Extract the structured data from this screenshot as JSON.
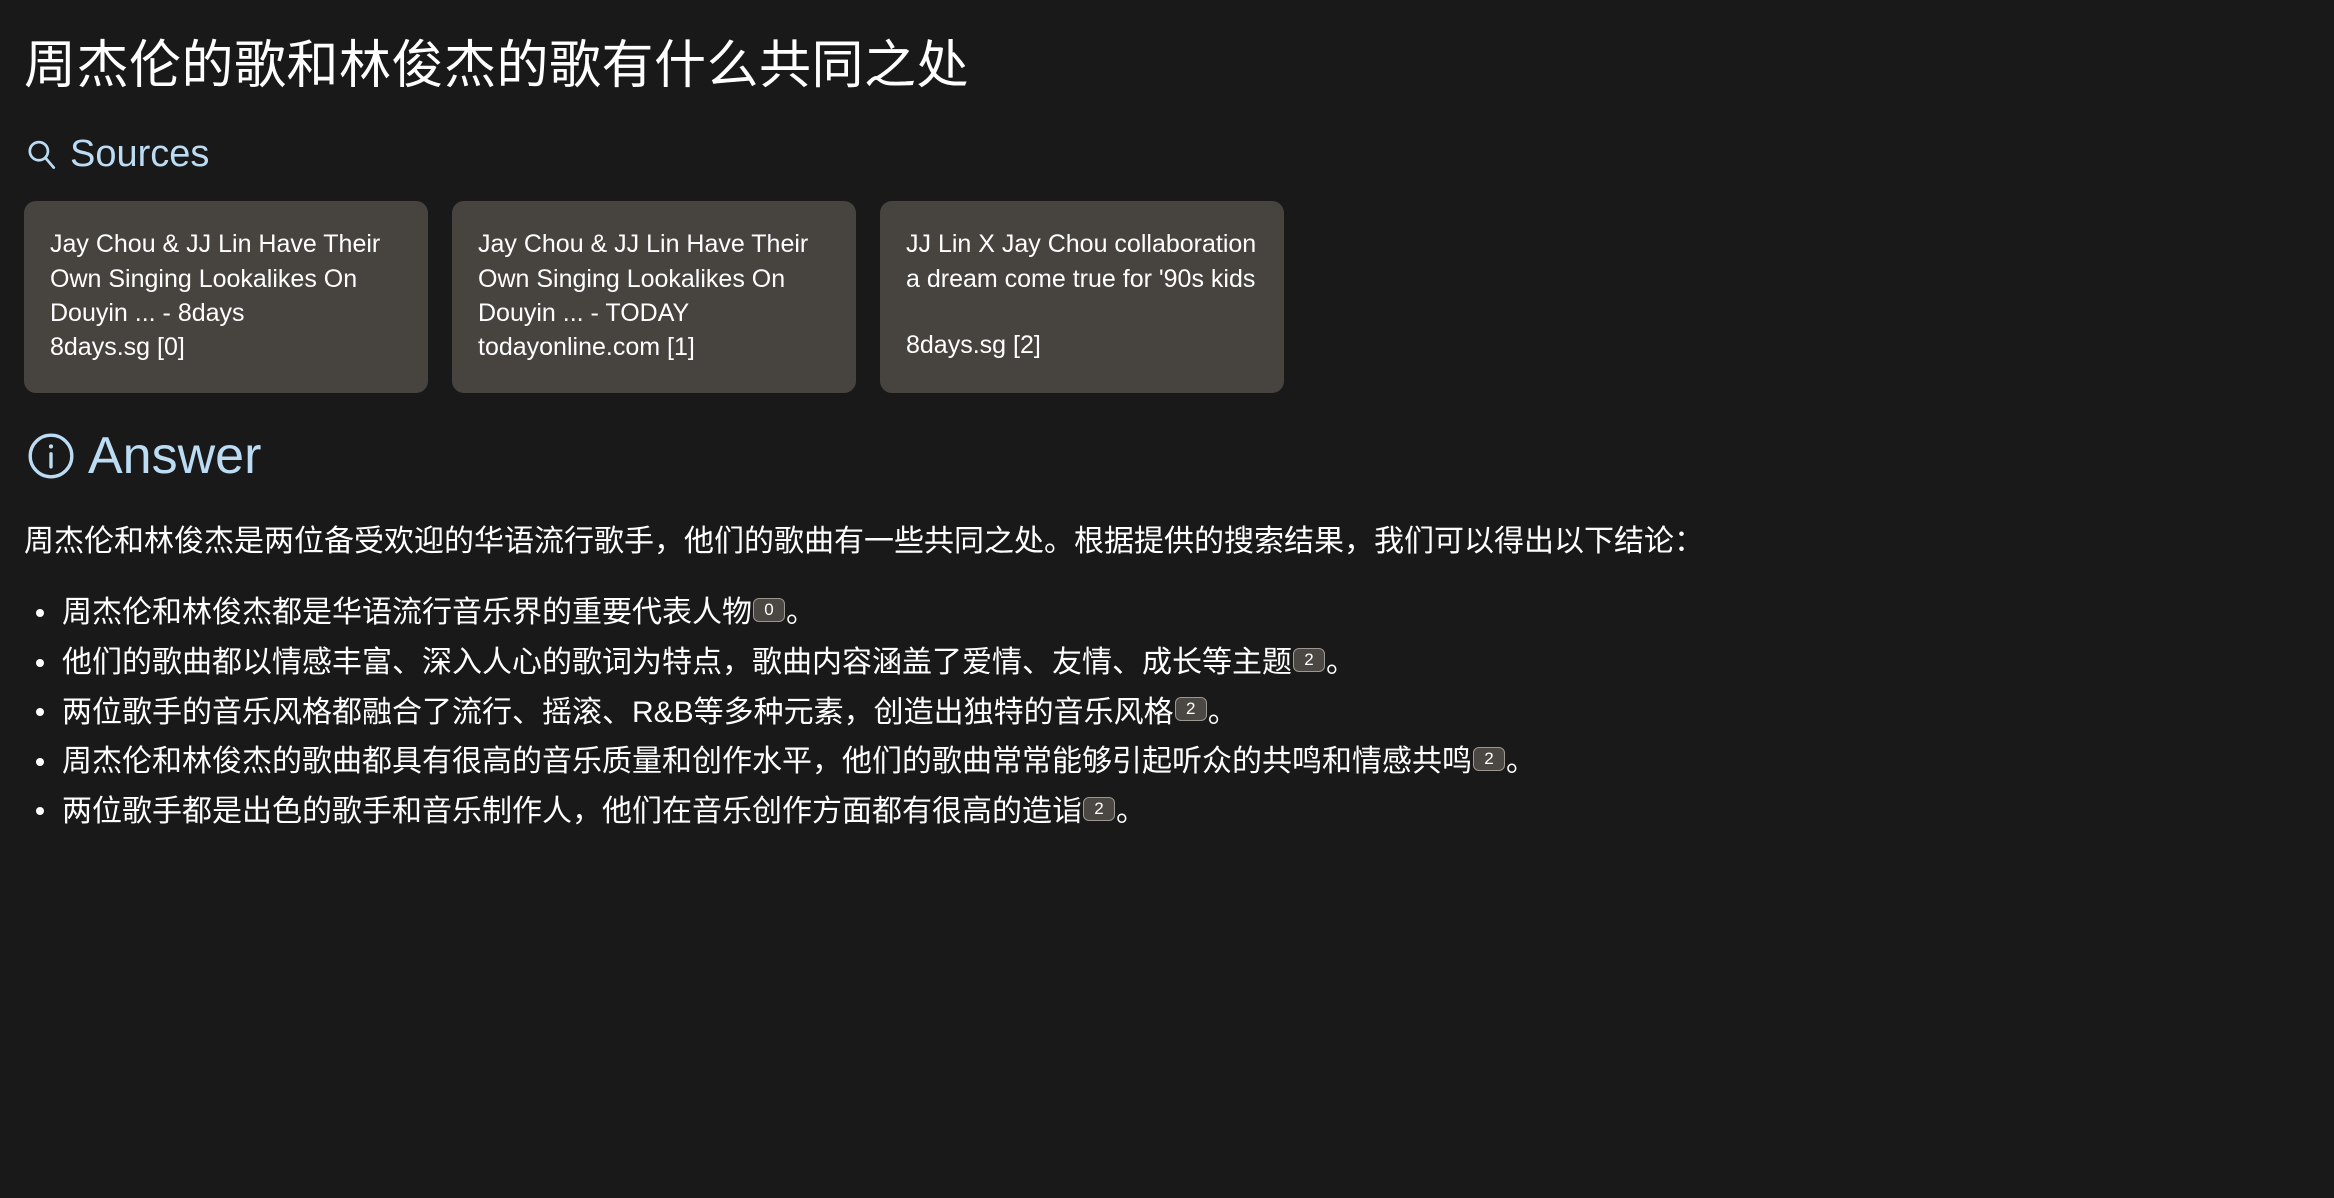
{
  "page": {
    "background_color": "#191919",
    "title": "周杰伦的歌和林俊杰的歌有什么共同之处"
  },
  "sources_section": {
    "label": "Sources",
    "icon": "search-icon",
    "accent_color": "#bcdcf4",
    "card_background": "#474440",
    "cards": [
      {
        "title": "Jay Chou & JJ Lin Have Their Own Singing Lookalikes On Douyin ... - 8days",
        "meta": "8days.sg [0]"
      },
      {
        "title": "Jay Chou & JJ Lin Have Their Own Singing Lookalikes On Douyin ... - TODAY",
        "meta": "todayonline.com [1]"
      },
      {
        "title": "JJ Lin X Jay Chou collaboration a dream come true for '90s kids",
        "meta": "8days.sg [2]"
      }
    ]
  },
  "answer_section": {
    "label": "Answer",
    "icon": "info-circle-icon",
    "accent_color": "#bcdcf4",
    "intro": "周杰伦和林俊杰是两位备受欢迎的华语流行歌手，他们的歌曲有一些共同之处。根据提供的搜索结果，我们可以得出以下结论：",
    "bullets": [
      {
        "text_before": "周杰伦和林俊杰都是华语流行音乐界的重要代表人物",
        "citation": "0",
        "text_after": "。"
      },
      {
        "text_before": "他们的歌曲都以情感丰富、深入人心的歌词为特点，歌曲内容涵盖了爱情、友情、成长等主题",
        "citation": "2",
        "text_after": "。"
      },
      {
        "text_before": "两位歌手的音乐风格都融合了流行、摇滚、R&B等多种元素，创造出独特的音乐风格",
        "citation": "2",
        "text_after": "。"
      },
      {
        "text_before": "周杰伦和林俊杰的歌曲都具有很高的音乐质量和创作水平，他们的歌曲常常能够引起听众的共鸣和情感共鸣",
        "citation": "2",
        "text_after": "。"
      },
      {
        "text_before": "两位歌手都是出色的歌手和音乐制作人，他们在音乐创作方面都有很高的造诣",
        "citation": "2",
        "text_after": "。"
      }
    ]
  }
}
